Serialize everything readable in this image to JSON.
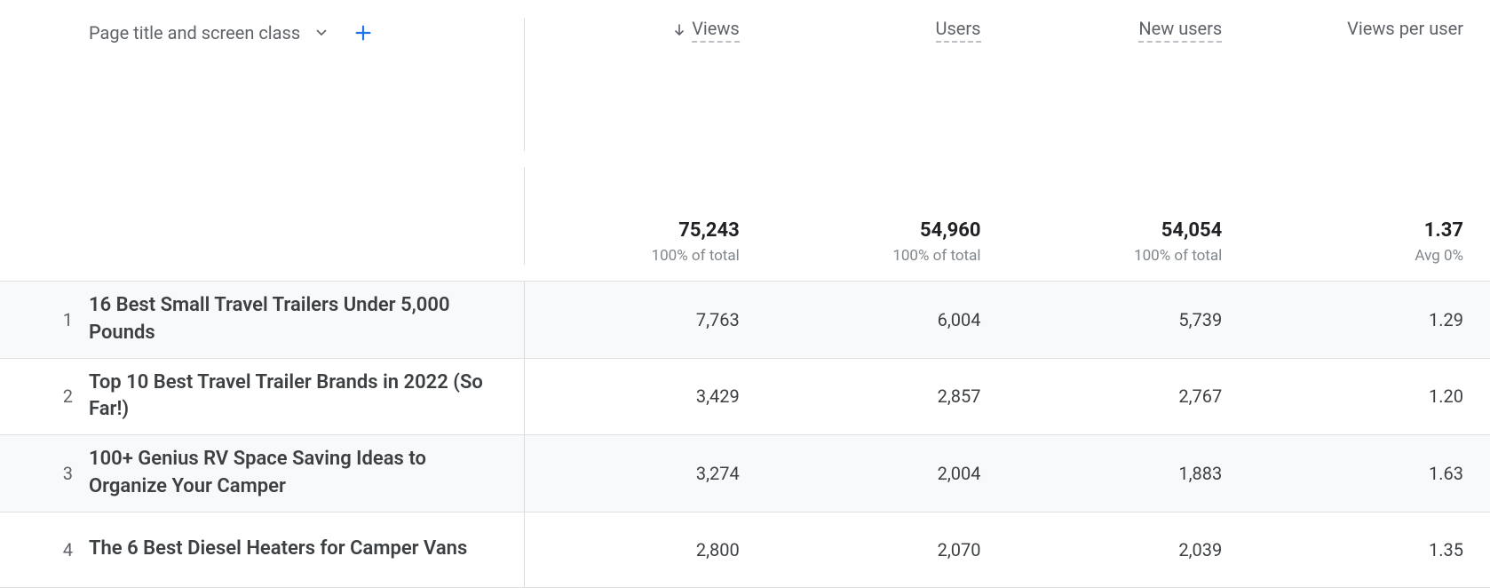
{
  "dimension": {
    "label": "Page title and screen class"
  },
  "columns": {
    "views": {
      "label": "Views",
      "sorted": true
    },
    "users": {
      "label": "Users"
    },
    "new_users": {
      "label": "New users"
    },
    "views_per_user": {
      "label": "Views per user"
    }
  },
  "summary": {
    "views": {
      "value": "75,243",
      "sub": "100% of total"
    },
    "users": {
      "value": "54,960",
      "sub": "100% of total"
    },
    "new_users": {
      "value": "54,054",
      "sub": "100% of total"
    },
    "views_per_user": {
      "value": "1.37",
      "sub": "Avg 0%"
    }
  },
  "rows": [
    {
      "index": "1",
      "title": "16 Best Small Travel Trailers Under 5,000 Pounds",
      "views": "7,763",
      "users": "6,004",
      "new_users": "5,739",
      "views_per_user": "1.29"
    },
    {
      "index": "2",
      "title": "Top 10 Best Travel Trailer Brands in 2022 (So Far!)",
      "views": "3,429",
      "users": "2,857",
      "new_users": "2,767",
      "views_per_user": "1.20"
    },
    {
      "index": "3",
      "title": "100+ Genius RV Space Saving Ideas to Organize Your Camper",
      "views": "3,274",
      "users": "2,004",
      "new_users": "1,883",
      "views_per_user": "1.63"
    },
    {
      "index": "4",
      "title": "The 6 Best Diesel Heaters for Camper Vans",
      "views": "2,800",
      "users": "2,070",
      "new_users": "2,039",
      "views_per_user": "1.35"
    }
  ]
}
